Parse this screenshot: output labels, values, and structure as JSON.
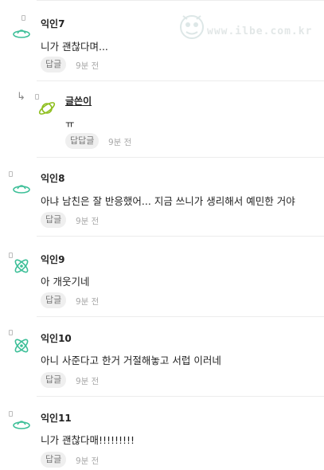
{
  "watermark": {
    "text": "www.ilbe.com.kr"
  },
  "comments": [
    {
      "name": "익인7",
      "text": "니가 괜찮다며...",
      "reply_label": "답글",
      "time": "9분 전",
      "icon": "ufo-icon"
    },
    {
      "name": "글쓴이",
      "text": "ㅠ",
      "reply_label": "답답글",
      "time": "9분 전",
      "icon": "planet-icon",
      "is_reply": true
    },
    {
      "name": "익인8",
      "text": "아냐 남친은 잘 반응했어... 지금 쓰니가 생리해서 예민한 거야",
      "reply_label": "답글",
      "time": "9분 전",
      "icon": "ufo-icon"
    },
    {
      "name": "익인9",
      "text": "아 개웃기네",
      "reply_label": "답글",
      "time": "9분 전",
      "icon": "atom-icon"
    },
    {
      "name": "익인10",
      "text": "아니 사준다고 한거 거절해놓고 서럽 이러네",
      "reply_label": "답글",
      "time": "9분 전",
      "icon": "atom-icon"
    },
    {
      "name": "익인11",
      "text": "니가 괜찮다매!!!!!!!!!",
      "reply_label": "답글",
      "time": "9분 전",
      "icon": "ufo-icon"
    }
  ],
  "colors": {
    "icon_green": "#3dbf98",
    "planet_green": "#8fbf1f",
    "divider": "#ececec"
  }
}
